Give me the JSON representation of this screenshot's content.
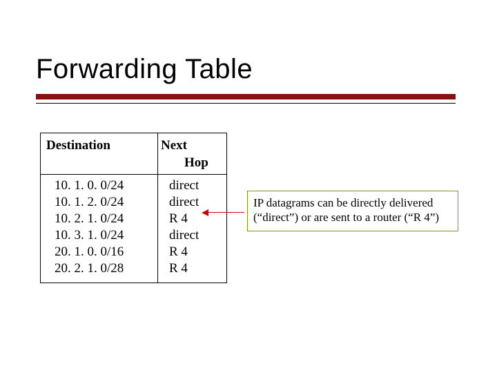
{
  "title": "Forwarding Table",
  "table": {
    "headers": {
      "destination": "Destination",
      "nexthop_line1": "Next",
      "nexthop_line2": "Hop"
    },
    "rows": [
      {
        "dest": "10. 1. 0. 0/24",
        "hop": "direct"
      },
      {
        "dest": "10. 1. 2. 0/24",
        "hop": "direct"
      },
      {
        "dest": "10. 2. 1. 0/24",
        "hop": "R 4"
      },
      {
        "dest": "10. 3. 1. 0/24",
        "hop": "direct"
      },
      {
        "dest": "20. 1. 0. 0/16",
        "hop": "R 4"
      },
      {
        "dest": "20. 2. 1. 0/28",
        "hop": "R 4"
      }
    ]
  },
  "callout": "IP datagrams can be directly delivered (“direct”) or are sent to a router (“R 4”)",
  "chart_data": {
    "type": "table",
    "title": "Forwarding Table",
    "columns": [
      "Destination",
      "Next Hop"
    ],
    "rows": [
      [
        "10.1.0.0/24",
        "direct"
      ],
      [
        "10.1.2.0/24",
        "direct"
      ],
      [
        "10.2.1.0/24",
        "R4"
      ],
      [
        "10.3.1.0/24",
        "direct"
      ],
      [
        "20.1.0.0/16",
        "R4"
      ],
      [
        "20.2.1.0/28",
        "R4"
      ]
    ],
    "annotation": "IP datagrams can be directly delivered (\"direct\") or are sent to a router (\"R4\")"
  }
}
